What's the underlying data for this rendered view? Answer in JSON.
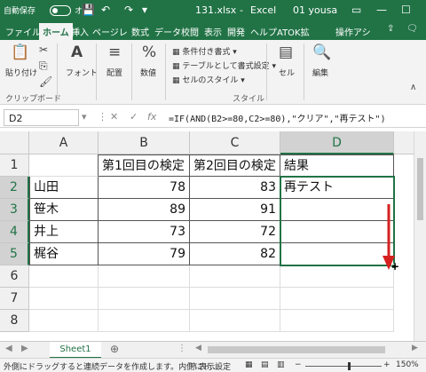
{
  "titlebar": {
    "autosave_label": "自動保存",
    "autosave_state": "オフ",
    "filename": "131.xlsx",
    "app": "Excel",
    "user": "01 yousa"
  },
  "tabs": [
    "ファイル",
    "ホーム",
    "挿入",
    "ページレ",
    "数式",
    "データ",
    "校閲",
    "表示",
    "開発",
    "ヘルプ",
    "ATOK拡",
    "操作アシ"
  ],
  "ribbon": {
    "paste": "貼り付け",
    "font": "フォント",
    "align": "配置",
    "number": "数値",
    "percent": "%",
    "cond_format": "条件付き書式",
    "table_format": "テーブルとして書式設定",
    "cell_style": "セルのスタイル",
    "cell": "セル",
    "edit": "編集",
    "group_clipboard": "クリップボード",
    "group_style": "スタイル"
  },
  "formula_bar": {
    "name_box": "D2",
    "fx": "fx",
    "formula": "=IF(AND(B2>=80,C2>=80),\"クリア\",\"再テスト\")"
  },
  "columns": [
    "A",
    "B",
    "C",
    "D"
  ],
  "rows": [
    "1",
    "2",
    "3",
    "4",
    "5",
    "6",
    "7",
    "8"
  ],
  "cells": {
    "B1": "第1回目の検定",
    "C1": "第2回目の検定",
    "D1": "結果",
    "A2": "山田",
    "B2": "78",
    "C2": "83",
    "D2": "再テスト",
    "A3": "笹木",
    "B3": "89",
    "C3": "91",
    "A4": "井上",
    "B4": "73",
    "C4": "72",
    "A5": "梶谷",
    "B5": "79",
    "C5": "82"
  },
  "sheet_tab": "Sheet1",
  "status": {
    "message": "外側にドラッグすると連続データを作成します。内側にド…",
    "display_settings": "表示設定",
    "zoom": "150%"
  },
  "colors": {
    "excel_green": "#217346",
    "arrow_red": "#d62020"
  }
}
